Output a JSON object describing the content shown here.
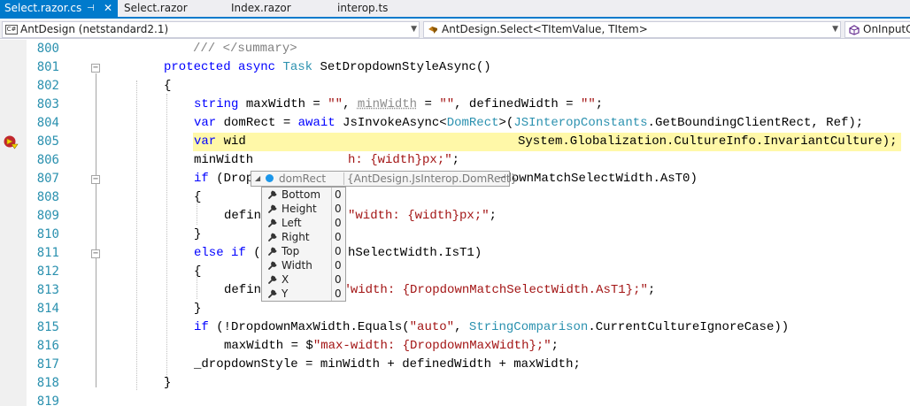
{
  "tabs": [
    {
      "label": "Select.razor.cs",
      "active": true
    },
    {
      "label": "Select.razor",
      "active": false
    },
    {
      "label": "Index.razor",
      "active": false
    },
    {
      "label": "interop.ts",
      "active": false
    }
  ],
  "tab_pin_glyph": "⊣",
  "tab_close_glyph": "✕",
  "navbar": {
    "project_icon_text": "C#",
    "project": "AntDesign (netstandard2.1)",
    "type": "AntDesign.Select<TItemValue, TItem>",
    "member": "OnInputC"
  },
  "lines": [
    {
      "num": "800"
    },
    {
      "num": "801"
    },
    {
      "num": "802"
    },
    {
      "num": "803"
    },
    {
      "num": "804"
    },
    {
      "num": "805"
    },
    {
      "num": "806"
    },
    {
      "num": "807"
    },
    {
      "num": "808"
    },
    {
      "num": "809"
    },
    {
      "num": "810"
    },
    {
      "num": "811"
    },
    {
      "num": "812"
    },
    {
      "num": "813"
    },
    {
      "num": "814"
    },
    {
      "num": "815"
    },
    {
      "num": "816"
    },
    {
      "num": "817"
    },
    {
      "num": "818"
    },
    {
      "num": "819"
    }
  ],
  "code": {
    "l800": "/// </summary>",
    "l801_kw1": "protected",
    "l801_kw2": "async",
    "l801_ty": "Task",
    "l801_rest": " SetDropdownStyleAsync()",
    "l802": "{",
    "l803_kw": "string",
    "l803_a": " maxWidth = ",
    "l803_s1": "\"\"",
    "l803_b": ", ",
    "l803_un": "minWidth",
    "l803_c": " = ",
    "l803_s2": "\"\"",
    "l803_d": ", definedWidth = ",
    "l803_s3": "\"\"",
    "l803_e": ";",
    "l804_kw1": "var",
    "l804_a": " domRect = ",
    "l804_kw2": "await",
    "l804_b": " JsInvokeAsync<",
    "l804_ty1": "DomRect",
    "l804_c": ">(",
    "l804_ty2": "JSInteropConstants",
    "l804_d": ".GetBoundingClientRect, Ref);",
    "l805_kw": "var",
    "l805_a": " wid",
    "l805_tail": "System.Globalization.CultureInfo.InvariantCulture);",
    "l806_a": "minWidth ",
    "l806_s": "h: {width}px;\"",
    "l806_b": ";",
    "l807_kw": "if",
    "l807_a": " (Dropd",
    "l807_b": "ectWidth.IsT0 && DropdownMatchSelectWidth.AsT0)",
    "l808": "{",
    "l809_a": "defin",
    "l809_s": "\"width: {width}px;\"",
    "l809_b": ";",
    "l810": "}",
    "l811_kw1": "else",
    "l811_kw2": "if",
    "l811_a": " (",
    "l811_b": "hSelectWidth.IsT1)",
    "l812": "{",
    "l813_a": "definedWidth = $",
    "l813_s": "\"width: {DropdownMatchSelectWidth.AsT1};\"",
    "l813_b": ";",
    "l814": "}",
    "l815_kw": "if",
    "l815_a": " (!DropdownMaxWidth.Equals(",
    "l815_s": "\"auto\"",
    "l815_b": ", ",
    "l815_ty": "StringComparison",
    "l815_c": ".CurrentCultureIgnoreCase))",
    "l816_a": "maxWidth = $",
    "l816_s": "\"max-width: {DropdownMaxWidth};\"",
    "l816_b": ";",
    "l817": "_dropdownStyle = minWidth + definedWidth + maxWidth;",
    "l818": "}",
    "l819": ""
  },
  "datatip": {
    "expand_glyph": "◢",
    "name": "domRect",
    "value": "{AntDesign.JsInterop.DomRect}",
    "pin_glyph": "⊣"
  },
  "members": [
    {
      "name": "Bottom",
      "value": "0"
    },
    {
      "name": "Height",
      "value": "0"
    },
    {
      "name": "Left",
      "value": "0"
    },
    {
      "name": "Right",
      "value": "0"
    },
    {
      "name": "Top",
      "value": "0"
    },
    {
      "name": "Width",
      "value": "0"
    },
    {
      "name": "X",
      "value": "0"
    },
    {
      "name": "Y",
      "value": "0"
    }
  ],
  "fold_collapse_glyph": "−",
  "icons": {
    "breakpoint": "breakpoint-current-statement-icon",
    "property": "wrench-icon",
    "class": "class-icon",
    "method": "method-icon"
  },
  "colors": {
    "accent": "#007acc",
    "keyword": "#0000ff",
    "type": "#2b91af",
    "string": "#a31515",
    "comment": "#808080",
    "highlight": "#fff8a8"
  }
}
